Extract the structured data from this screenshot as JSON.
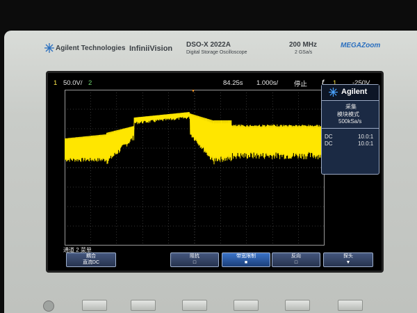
{
  "brand": {
    "company": "Agilent Technologies",
    "series": "InfiniiVision",
    "model": "DSO-X 2022A",
    "model_subtitle": "Digital Storage Oscilloscope",
    "bandwidth": "200 MHz",
    "sample_rate": "2 GSa/s",
    "badge": "MEGAZoom"
  },
  "status_bar": {
    "ch1_num": "1",
    "ch1_scale": "50.0V/",
    "ch2_num": "2",
    "time_offset": "84.25s",
    "time_scale": "1.000s/",
    "run_state": "停止",
    "trig_symbol": "f",
    "trig_channel": "1",
    "trig_level": "-250V"
  },
  "side_panel": {
    "logo": "Agilent",
    "acq_title": "采集",
    "acq_mode": "模块模式",
    "acq_rate": "500kSa/s",
    "ch1_coupling": "DC",
    "ch1_probe": "10.0:1",
    "ch2_coupling": "DC",
    "ch2_probe": "10.0:1"
  },
  "menu_title": "通道 2 菜单",
  "softkeys": [
    {
      "label": "耦合",
      "value": "直流DC"
    },
    {
      "label": "阻抗",
      "value": "□"
    },
    {
      "label": "带宽限制",
      "value": "■"
    },
    {
      "label": "反向",
      "value": "□"
    },
    {
      "label": "探头",
      "value": "▼"
    }
  ],
  "colors": {
    "trace": "#ffe600",
    "grid": "#6a6a6a",
    "panel": "#1b2a44"
  }
}
